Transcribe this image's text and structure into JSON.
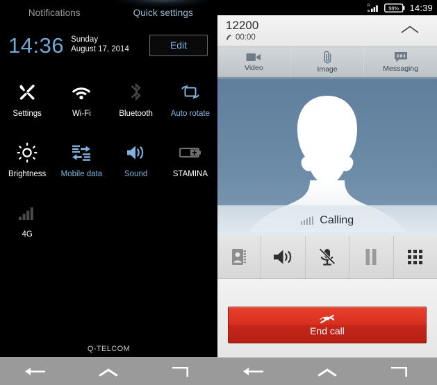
{
  "quick_settings_panel": {
    "tabs": [
      {
        "label": "Notifications",
        "active": false
      },
      {
        "label": "Quick settings",
        "active": true
      }
    ],
    "clock": {
      "time": "14:36",
      "day": "Sunday",
      "date": "August 17, 2014"
    },
    "edit_button": "Edit",
    "tiles": [
      {
        "label": "Settings",
        "icon": "wrench-screwdriver-icon",
        "state": "white"
      },
      {
        "label": "Wi-Fi",
        "icon": "wifi-icon",
        "state": "white"
      },
      {
        "label": "Bluetooth",
        "icon": "bluetooth-icon",
        "state": "dim"
      },
      {
        "label": "Auto rotate",
        "icon": "auto-rotate-icon",
        "state": "blue"
      },
      {
        "label": "Brightness",
        "icon": "brightness-sun-icon",
        "state": "white"
      },
      {
        "label": "Mobile data",
        "icon": "mobile-data-icon",
        "state": "blue"
      },
      {
        "label": "Sound",
        "icon": "speaker-sound-icon",
        "state": "blue"
      },
      {
        "label": "STAMINA",
        "icon": "battery-plus-icon",
        "state": "dim"
      },
      {
        "label": "4G",
        "icon": "signal-bars-icon",
        "state": "dim"
      }
    ],
    "carrier": "Q-TELCOM"
  },
  "call_panel": {
    "status_bar": {
      "roaming_label": "R",
      "battery_percent": "98%",
      "time": "14:39"
    },
    "call_header": {
      "number": "12200",
      "duration": "00:00"
    },
    "share_tabs": [
      {
        "label": "Video",
        "icon": "video-camera-icon"
      },
      {
        "label": "Image",
        "icon": "paperclip-icon"
      },
      {
        "label": "Messaging",
        "icon": "message-bubble-icon"
      }
    ],
    "call_state": "Calling",
    "controls": [
      {
        "name": "contacts",
        "icon": "contacts-book-icon",
        "enabled": false
      },
      {
        "name": "speaker",
        "icon": "speaker-icon",
        "enabled": true
      },
      {
        "name": "mute",
        "icon": "mic-muted-icon",
        "enabled": true
      },
      {
        "name": "hold",
        "icon": "pause-icon",
        "enabled": false
      },
      {
        "name": "keypad",
        "icon": "dialpad-grid-icon",
        "enabled": true
      }
    ],
    "end_call_button": {
      "label": "End call",
      "icon": "phone-hangup-icon",
      "color": "#c4261a"
    }
  },
  "navigation_bar": {
    "buttons": [
      {
        "name": "back",
        "icon": "back-arrow-icon"
      },
      {
        "name": "home",
        "icon": "chevron-up-icon"
      },
      {
        "name": "recents",
        "icon": "recents-icon"
      }
    ]
  },
  "theme": {
    "accent_blue": "#7fb2dc",
    "photo_blue": "#6b8aa6",
    "end_call_red": "#c4261a"
  }
}
